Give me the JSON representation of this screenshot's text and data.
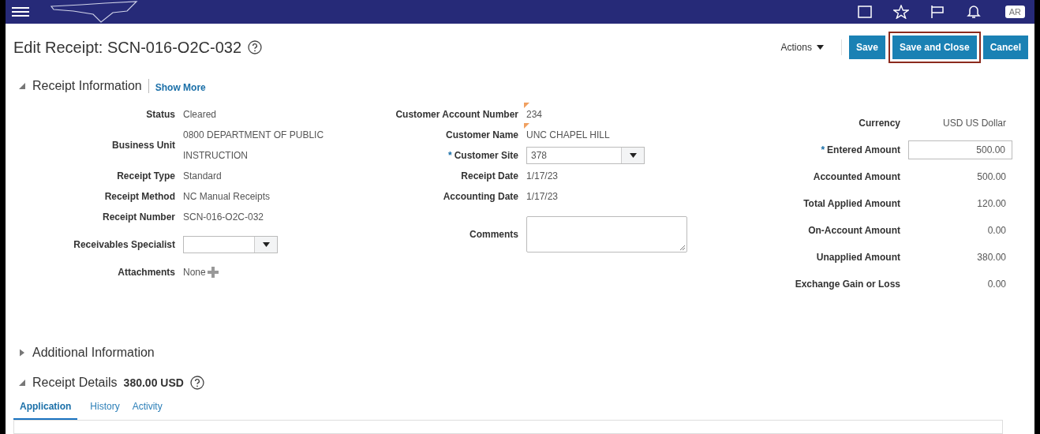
{
  "header": {
    "avatar": "AR"
  },
  "page": {
    "title": "Edit Receipt: SCN-016-O2C-032"
  },
  "toolbar": {
    "actions": "Actions",
    "buttons": [
      {
        "label": "Save",
        "highlighted": false
      },
      {
        "label": "Save and Close",
        "highlighted": true
      },
      {
        "label": "Cancel",
        "highlighted": false
      }
    ]
  },
  "receipt_information": {
    "title": "Receipt Information",
    "expanded": true,
    "link": "Show More",
    "columns": [
      [
        {
          "kind": "text",
          "label": "Status",
          "value": "Cleared"
        },
        {
          "kind": "text",
          "label": "Business Unit",
          "value": "0800 DEPARTMENT OF PUBLIC INSTRUCTION"
        },
        {
          "kind": "text",
          "label": "Receipt Type",
          "value": "Standard"
        },
        {
          "kind": "text",
          "label": "Receipt Method",
          "value": "NC Manual Receipts"
        },
        {
          "kind": "text",
          "label": "Receipt Number",
          "value": "SCN-016-O2C-032"
        },
        {
          "kind": "select",
          "label": "Receivables Specialist"
        },
        {
          "kind": "attachments",
          "label": "Attachments",
          "value": "None"
        }
      ],
      [
        {
          "kind": "text",
          "label": "Customer Account Number",
          "value": "234",
          "changed": true
        },
        {
          "kind": "text",
          "label": "Customer Name",
          "value": "UNC CHAPEL HILL",
          "changed": true
        },
        {
          "kind": "select",
          "label": "Customer Site",
          "value": "378",
          "required_mark": "*"
        },
        {
          "kind": "text",
          "label": "Receipt Date",
          "value": "1/17/23"
        },
        {
          "kind": "text",
          "label": "Accounting Date",
          "value": "1/17/23"
        },
        {
          "kind": "textarea",
          "label": "Comments"
        }
      ],
      [
        {
          "kind": "amount",
          "label": "Currency",
          "value": "USD US Dollar"
        },
        {
          "kind": "input",
          "label": "Entered Amount",
          "value": "500.00",
          "required_mark": "*"
        },
        {
          "kind": "amount",
          "label": "Accounted Amount",
          "value": "500.00"
        },
        {
          "kind": "amount",
          "label": "Total Applied Amount",
          "value": "120.00"
        },
        {
          "kind": "amount",
          "label": "On-Account Amount",
          "value": "0.00"
        },
        {
          "kind": "amount",
          "label": "Unapplied Amount",
          "value": "380.00"
        },
        {
          "kind": "amount",
          "label": "Exchange Gain or Loss",
          "value": "0.00"
        }
      ]
    ]
  },
  "additional_information": {
    "title": "Additional Information",
    "expanded": false
  },
  "receipt_details": {
    "title": "Receipt Details",
    "amount": "380.00 USD",
    "expanded": true
  },
  "tabs": [
    {
      "label": "Application",
      "selected": true
    },
    {
      "label": "History",
      "selected": false
    },
    {
      "label": "Activity",
      "selected": false
    }
  ]
}
